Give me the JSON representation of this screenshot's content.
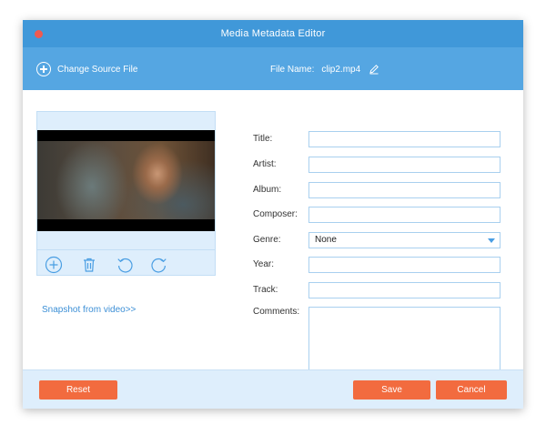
{
  "window": {
    "title": "Media Metadata Editor",
    "colors": {
      "titlebar": "#4098d9",
      "toolbar": "#55a6e2",
      "accent_button": "#f26b3f",
      "close": "#ef5a50"
    }
  },
  "toolbar": {
    "change_source_label": "Change Source File",
    "file_name_label": "File Name:",
    "file_name_value": "clip2.mp4"
  },
  "preview": {
    "tools": [
      "add-icon",
      "trash-icon",
      "rotate-left-icon",
      "rotate-right-icon"
    ],
    "snapshot_link": "Snapshot from video>>"
  },
  "form": {
    "title_label": "Title:",
    "artist_label": "Artist:",
    "album_label": "Album:",
    "composer_label": "Composer:",
    "genre_label": "Genre:",
    "genre_value": "None",
    "year_label": "Year:",
    "track_label": "Track:",
    "comments_label": "Comments:",
    "title_value": "",
    "artist_value": "",
    "album_value": "",
    "composer_value": "",
    "year_value": "",
    "track_value": "",
    "comments_value": ""
  },
  "footer": {
    "reset_label": "Reset",
    "save_label": "Save",
    "cancel_label": "Cancel"
  }
}
